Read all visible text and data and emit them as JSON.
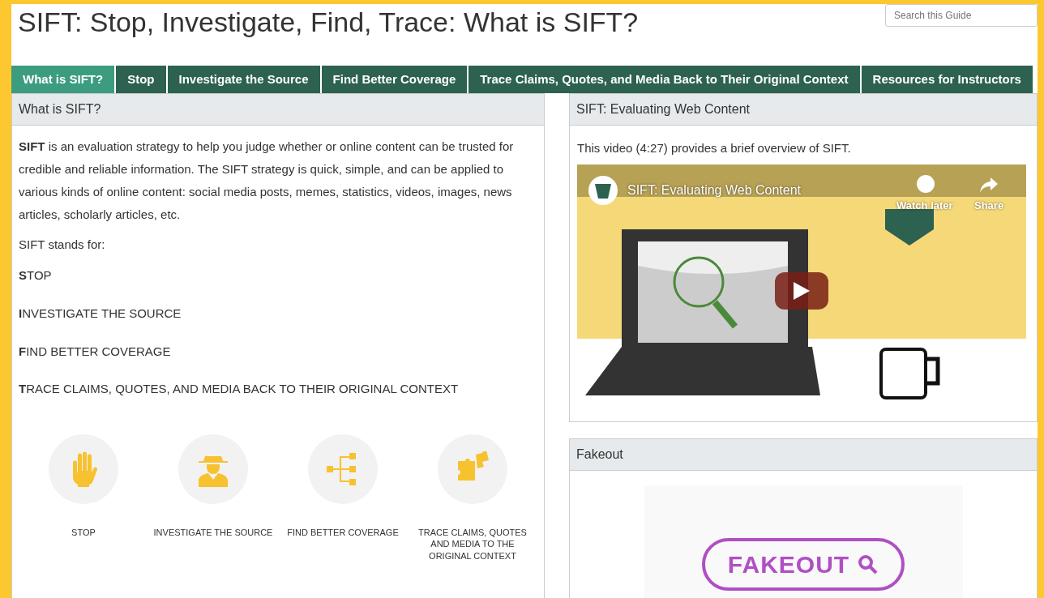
{
  "page_title": "SIFT: Stop, Investigate, Find, Trace: What is SIFT?",
  "search": {
    "placeholder": "Search this Guide"
  },
  "tabs": [
    {
      "label": "What is SIFT?",
      "selected": true
    },
    {
      "label": "Stop",
      "selected": false
    },
    {
      "label": "Investigate the Source",
      "selected": false
    },
    {
      "label": "Find Better Coverage",
      "selected": false
    },
    {
      "label": "Trace Claims, Quotes, and Media Back to Their Original Context",
      "selected": false
    },
    {
      "label": "Resources for Instructors",
      "selected": false
    }
  ],
  "left_panel": {
    "heading": "What is SIFT?",
    "intro": "**SIFT** is an evaluation strategy to help you judge whether or online content can be trusted for credible and reliable information. The SIFT strategy is quick, simple, and can be applied to various kinds of online content: social media posts, memes, statistics, videos, images, news articles, scholarly articles, etc.",
    "stands_for": "SIFT stands for:",
    "steps": [
      "**S**TOP",
      "**I**NVESTIGATE THE SOURCE",
      "**F**IND BETTER COVERAGE",
      "**T**RACE CLAIMS, QUOTES, AND MEDIA BACK TO THEIR ORIGINAL CONTEXT"
    ],
    "icons": [
      {
        "kind": "hand",
        "label": "STOP"
      },
      {
        "kind": "detective",
        "label": "INVESTIGATE THE SOURCE"
      },
      {
        "kind": "tree",
        "label": "FIND BETTER COVERAGE"
      },
      {
        "kind": "puzzle",
        "label": "TRACE CLAIMS, QUOTES AND MEDIA TO THE ORIGINAL CONTEXT"
      }
    ]
  },
  "video_panel": {
    "heading": "SIFT: Evaluating Web Content",
    "caption": "This video (4:27) provides a brief overview of SIFT.",
    "video": {
      "kind": "picture",
      "title": "SIFT: Evaluating Web Content",
      "watch_later": "Watch later",
      "share": "Share"
    }
  },
  "fakeout_panel": {
    "heading": "Fakeout",
    "logo_text": "FAKEOUT"
  }
}
